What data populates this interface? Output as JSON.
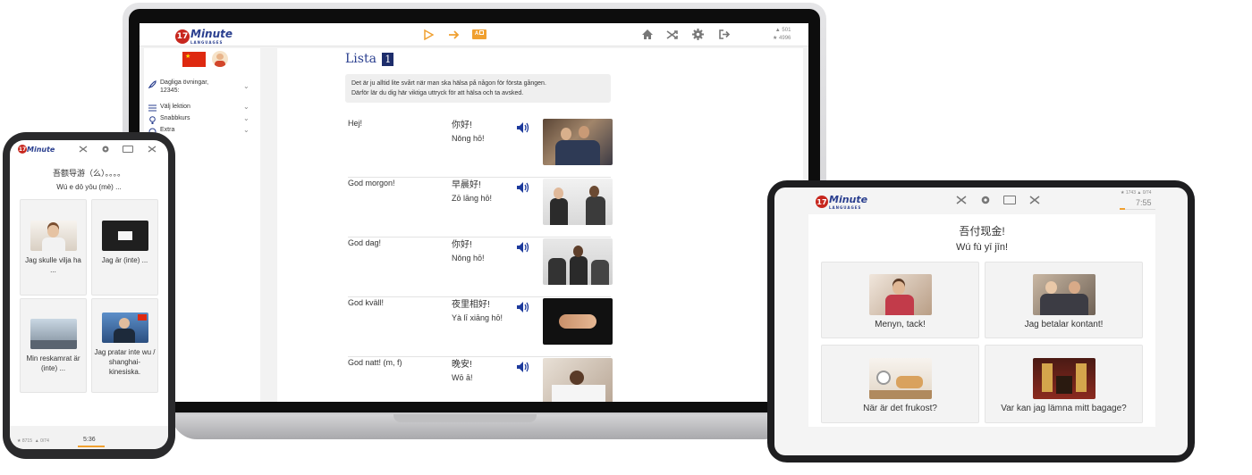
{
  "brand": {
    "logo_number": "17",
    "logo_word": "Minute",
    "logo_sub": "LANGUAGES"
  },
  "laptop": {
    "toolbar": {
      "play_icon": "play-icon",
      "next_icon": "arrow-right-icon",
      "flashcard_icon": "flashcard-icon"
    },
    "top_right_icons": [
      "home-icon",
      "shuffle-icon",
      "gear-icon",
      "logout-icon"
    ],
    "stats": {
      "caps": "501",
      "stars": "4996"
    },
    "sidebar": {
      "daily_label": "Dagliga övningar, 12345:",
      "items": [
        {
          "label": "Välj lektion"
        },
        {
          "label": "Snabbkurs"
        },
        {
          "label": "Extra"
        }
      ]
    },
    "lesson": {
      "title": "Lista",
      "number": "1",
      "intro_line1": "Det är ju alltid lite svårt när man ska hälsa på någon för första gången.",
      "intro_line2": "Därför lär du dig här viktiga uttryck för att hälsa och ta avsked.",
      "rows": [
        {
          "sv": "Hej!",
          "zh": "你好!",
          "pinyin": "Nǒng hō!"
        },
        {
          "sv": "God morgon!",
          "zh": "早晨好!",
          "pinyin": "Zō lāng hō!"
        },
        {
          "sv": "God dag!",
          "zh": "你好!",
          "pinyin": "Nǒng hō!"
        },
        {
          "sv": "God kväll!",
          "zh": "夜里相好!",
          "pinyin": "Yà lī xiāng hō!"
        },
        {
          "sv": "God natt! (m, f)",
          "zh": "晚安!",
          "pinyin": "Wō ā!"
        }
      ]
    }
  },
  "phone": {
    "question_zh": "吾额导游（么）。。。。",
    "question_pinyin": "Wú e dō yōu (mè) ...",
    "options": [
      {
        "label": "Jag skulle vilja ha ..."
      },
      {
        "label": "Jag är (inte) ..."
      },
      {
        "label": "Min reskamrat är (inte) ..."
      },
      {
        "label": "Jag pratar inte wu / shanghai-kinesiska."
      }
    ],
    "footer_stats": "8715",
    "footer_stats2": "0/74",
    "timer": "5:36"
  },
  "tablet": {
    "stats": "1743",
    "stats2": "0/74",
    "timer": "7:55",
    "question_zh": "吾付现金!",
    "question_pinyin": "Wú fù yī jīn!",
    "options": [
      {
        "label": "Menyn, tack!"
      },
      {
        "label": "Jag betalar kontant!"
      },
      {
        "label": "När är det frukost?"
      },
      {
        "label": "Var kan jag lämna mitt bagage?"
      }
    ]
  },
  "colors": {
    "accent_orange": "#f0a030",
    "brand_blue": "#2a3f8f",
    "brand_red": "#c7271e",
    "speaker_blue": "#1d3a9c"
  }
}
